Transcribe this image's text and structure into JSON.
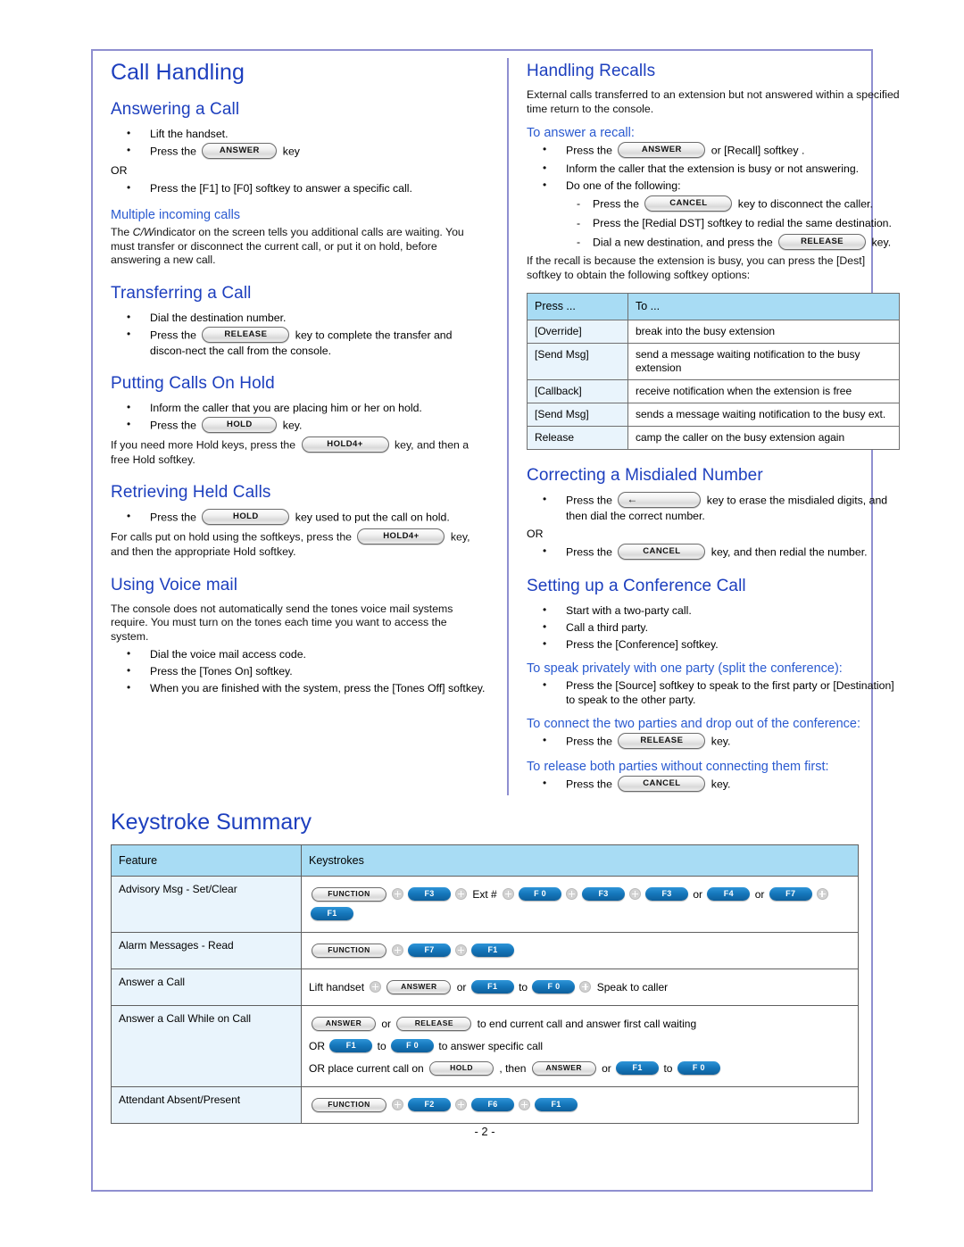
{
  "page": {
    "title": "Call Handling",
    "folio": "- 2 -"
  },
  "left_column": {
    "answering": {
      "heading": "Answering a Call",
      "bullets": [
        {
          "pre": "Lift the handset.",
          "key": null,
          "post": ""
        },
        {
          "pre": "Press the",
          "key": "ANSWER",
          "post": "key"
        }
      ],
      "or": "OR",
      "or_bullet": "Press the [F1] to [F0] softkey to answer a specific call."
    },
    "multiple_calls": {
      "heading": "Multiple incoming calls",
      "text_pre": "The ",
      "text_italic": "C/W",
      "text_post": "indicator on the screen tells you additional calls are waiting. You must transfer or disconnect the current call, or put it on hold, before answering a new call."
    },
    "transferring": {
      "heading": "Transferring a Call",
      "bullet1": "Dial the destination number.",
      "bullet2_pre": "Press the",
      "bullet2_key": "RELEASE",
      "bullet2_post": "key to complete the transfer and discon-nect the call from the console."
    },
    "hold": {
      "heading": "Putting Calls On Hold",
      "bullet1": "Inform the caller that you are placing him or her on hold.",
      "bullet2_pre": "Press the",
      "bullet2_key": "HOLD",
      "bullet2_post": "key.",
      "note_pre": "If you need more Hold keys, press the",
      "note_key": "HOLD4+",
      "note_post": "key, and then a free Hold softkey."
    },
    "retrieving": {
      "heading": "Retrieving Held Calls",
      "bullet_pre": "Press the",
      "bullet_key": "HOLD",
      "bullet_post": "key used to put the call on hold.",
      "note_pre": "For calls put on hold using the softkeys, press the",
      "note_key": "HOLD4+",
      "note_post": "key, and then the appropriate Hold softkey."
    },
    "voicemail": {
      "heading": "Using Voice mail",
      "intro": "The console does not automatically send the tones voice mail systems require. You must turn on the tones each time you want to access the system.",
      "bullets": [
        "Dial the voice mail access code.",
        "Press the  [Tones On]  softkey.",
        "When you are finished with the system, press the [Tones Off] softkey."
      ]
    }
  },
  "right_column": {
    "recalls": {
      "heading": "Handling Recalls",
      "intro": "External calls transferred to an extension but not answered within a specified time return to the console.",
      "sub_heading": "To answer a recall:",
      "b1_pre": "Press the",
      "b1_key": "ANSWER",
      "b1_post": "or [Recall] softkey .",
      "b2": "Inform the caller that the extension is busy or not answering.",
      "b3": "Do one of the following:",
      "dashes": [
        {
          "pre": "Press the",
          "key": "CANCEL",
          "post": "key to disconnect the caller."
        },
        {
          "pre": "Press the [Redial DST] softkey to redial the same destination.",
          "key": null,
          "post": ""
        },
        {
          "pre": "Dial a new destination, and press the",
          "key": "RELEASE",
          "post": "key."
        }
      ],
      "busy_note": "If the recall is because the extension is busy, you can press the [Dest] softkey to obtain the following softkey options:"
    },
    "options_table": {
      "headers": [
        "Press ...",
        "To ..."
      ],
      "rows": [
        [
          "[Override]",
          "break into the busy extension"
        ],
        [
          "[Send Msg]",
          "send a message waiting notification to the busy extension"
        ],
        [
          "[Callback]",
          "receive notification when the extension is free"
        ],
        [
          "[Send Msg]",
          "sends a message waiting notification to the busy ext."
        ],
        [
          "Release",
          "camp the caller on the busy extension again"
        ]
      ]
    },
    "misdialed": {
      "heading": "Correcting a Misdialed Number",
      "b1_pre": "Press the",
      "b1_key": "←",
      "b1_post": "key to erase the misdialed digits, and then dial the correct number.",
      "or": "OR",
      "b2_pre": "Press the",
      "b2_key": "CANCEL",
      "b2_post": "key, and then redial the number."
    },
    "conference": {
      "heading": "Setting up a Conference Call",
      "bullets": [
        "Start with a two-party call.",
        "Call a third party.",
        "Press the [Conference] softkey."
      ],
      "split_heading": "To speak privately with one party (split the conference):",
      "split_bullet": "Press the [Source] softkey to speak to the first party or [Destination] to speak to the other party.",
      "connect_heading": "To connect the two parties and drop out of the conference:",
      "connect_pre": "Press the",
      "connect_key": "RELEASE",
      "connect_post": "key.",
      "release_heading": "To release both parties without connecting them first:",
      "release_pre": "Press the",
      "release_key": "CANCEL",
      "release_post": "key."
    }
  },
  "keystroke_summary": {
    "title": "Keystroke Summary",
    "headers": [
      "Feature",
      "Keystrokes"
    ],
    "rows": [
      {
        "feature": "Advisory Msg - Set/Clear",
        "lines": [
          [
            {
              "t": "key",
              "v": "FUNCTION"
            },
            {
              "t": "plus"
            },
            {
              "t": "fkey",
              "v": "F3"
            },
            {
              "t": "plus"
            },
            {
              "t": "text",
              "v": "Ext #"
            },
            {
              "t": "plus"
            },
            {
              "t": "fkey",
              "v": "F 0"
            },
            {
              "t": "plus"
            },
            {
              "t": "fkey",
              "v": "F3"
            },
            {
              "t": "plus"
            },
            {
              "t": "fkey",
              "v": "F3"
            },
            {
              "t": "text",
              "v": "or"
            },
            {
              "t": "fkey",
              "v": "F4"
            },
            {
              "t": "text",
              "v": "or"
            },
            {
              "t": "fkey",
              "v": "F7"
            },
            {
              "t": "plus"
            },
            {
              "t": "fkey",
              "v": "F1"
            }
          ]
        ]
      },
      {
        "feature": "Alarm Messages - Read",
        "lines": [
          [
            {
              "t": "key",
              "v": "FUNCTION"
            },
            {
              "t": "plus"
            },
            {
              "t": "fkey",
              "v": "F7"
            },
            {
              "t": "plus"
            },
            {
              "t": "fkey",
              "v": "F1"
            }
          ]
        ]
      },
      {
        "feature": "Answer a Call",
        "lines": [
          [
            {
              "t": "text",
              "v": "Lift handset"
            },
            {
              "t": "plus"
            },
            {
              "t": "key",
              "v": "ANSWER"
            },
            {
              "t": "text",
              "v": "or"
            },
            {
              "t": "fkey",
              "v": "F1"
            },
            {
              "t": "text",
              "v": "to"
            },
            {
              "t": "fkey",
              "v": "F 0"
            },
            {
              "t": "plus"
            },
            {
              "t": "text",
              "v": "Speak to caller"
            }
          ]
        ]
      },
      {
        "feature": "Answer a Call While on Call",
        "lines": [
          [
            {
              "t": "key",
              "v": "ANSWER"
            },
            {
              "t": "text",
              "v": "or"
            },
            {
              "t": "key",
              "v": "RELEASE"
            },
            {
              "t": "text",
              "v": "to end current call and answer first call waiting"
            }
          ],
          [
            {
              "t": "text",
              "v": "OR"
            },
            {
              "t": "fkey",
              "v": "F1"
            },
            {
              "t": "text",
              "v": "to"
            },
            {
              "t": "fkey",
              "v": "F 0"
            },
            {
              "t": "text",
              "v": "to answer specific call"
            }
          ],
          [
            {
              "t": "text",
              "v": "OR place current call on"
            },
            {
              "t": "key",
              "v": "HOLD"
            },
            {
              "t": "text",
              "v": ", then"
            },
            {
              "t": "key",
              "v": "ANSWER"
            },
            {
              "t": "text",
              "v": "or"
            },
            {
              "t": "fkey",
              "v": "F1"
            },
            {
              "t": "text",
              "v": "to"
            },
            {
              "t": "fkey",
              "v": "F 0"
            }
          ]
        ]
      },
      {
        "feature": "Attendant Absent/Present",
        "lines": [
          [
            {
              "t": "key",
              "v": "FUNCTION"
            },
            {
              "t": "plus"
            },
            {
              "t": "fkey",
              "v": "F2"
            },
            {
              "t": "plus"
            },
            {
              "t": "fkey",
              "v": "F6"
            },
            {
              "t": "plus"
            },
            {
              "t": "fkey",
              "v": "F1"
            }
          ]
        ]
      }
    ]
  },
  "colors": {
    "heading_blue": "#1d3fbe",
    "subheading_blue": "#2a5ad0",
    "table_header_blue": "#a8dcf4",
    "table_cell_blue": "#e9f4fc",
    "page_border": "#8f8fd0",
    "fkey_blue": "#1577bb"
  }
}
